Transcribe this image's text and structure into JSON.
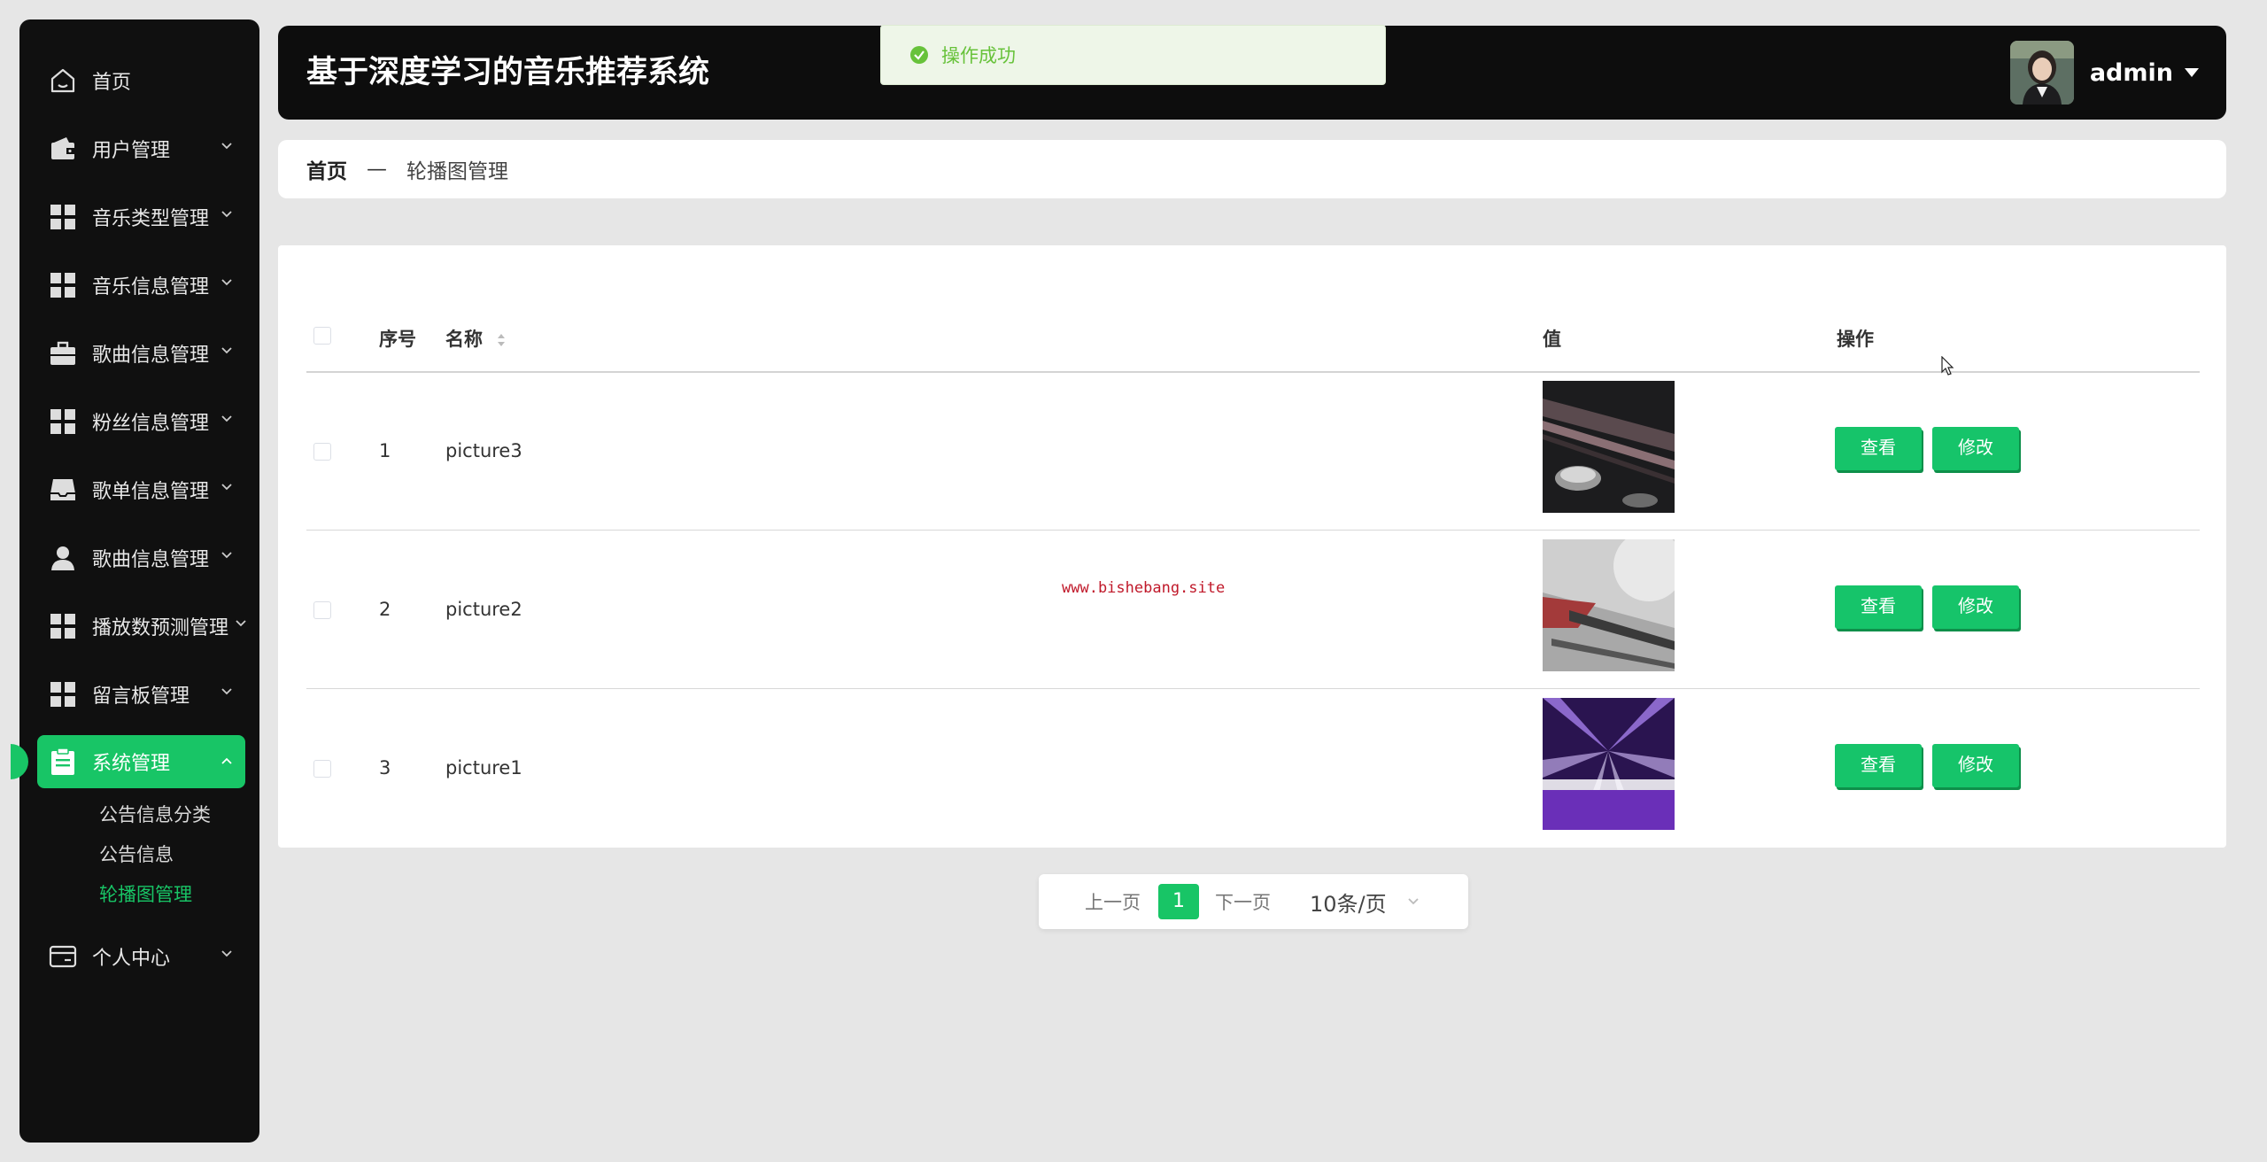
{
  "sidebar": {
    "items": [
      {
        "label": "首页",
        "icon": "home-icon"
      },
      {
        "label": "用户管理",
        "icon": "wallet-icon"
      },
      {
        "label": "音乐类型管理",
        "icon": "grid-icon"
      },
      {
        "label": "音乐信息管理",
        "icon": "grid-icon"
      },
      {
        "label": "歌曲信息管理",
        "icon": "briefcase-icon"
      },
      {
        "label": "粉丝信息管理",
        "icon": "grid-icon"
      },
      {
        "label": "歌单信息管理",
        "icon": "inbox-icon"
      },
      {
        "label": "歌曲信息管理",
        "icon": "user-icon"
      },
      {
        "label": "播放数预测管理",
        "icon": "grid-icon"
      },
      {
        "label": "留言板管理",
        "icon": "grid-icon"
      },
      {
        "label": "系统管理",
        "icon": "clipboard-icon"
      },
      {
        "label": "个人中心",
        "icon": "card-icon"
      }
    ],
    "system_submenu": [
      "公告信息分类",
      "公告信息",
      "轮播图管理"
    ],
    "active_color": "#18c566"
  },
  "header": {
    "title": "基于深度学习的音乐推荐系统",
    "username": "admin"
  },
  "toast": {
    "message": "操作成功"
  },
  "breadcrumb": {
    "home": "首页",
    "separator": "—",
    "current": "轮播图管理"
  },
  "table": {
    "headers": {
      "index": "序号",
      "name": "名称",
      "value": "值",
      "actions": "操作"
    },
    "rows": [
      {
        "index": "1",
        "name": "picture3",
        "view": "查看",
        "edit": "修改"
      },
      {
        "index": "2",
        "name": "picture2",
        "view": "查看",
        "edit": "修改"
      },
      {
        "index": "3",
        "name": "picture1",
        "view": "查看",
        "edit": "修改"
      }
    ]
  },
  "watermark": "www.bishebang.site",
  "pagination": {
    "prev": "上一页",
    "current_page": "1",
    "next": "下一页",
    "page_size": "10条/页"
  }
}
